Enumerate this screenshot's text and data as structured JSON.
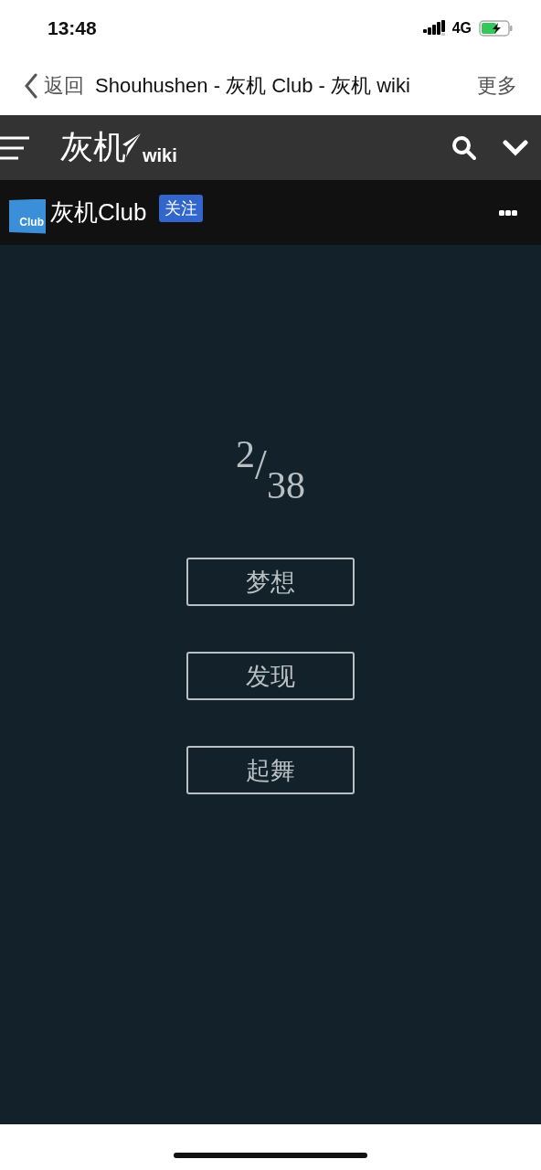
{
  "status_bar": {
    "time": "13:48",
    "network": "4G"
  },
  "nav_bar": {
    "back": "返回",
    "title": "Shouhushen - 灰机 Club - 灰机 wiki",
    "more": "更多"
  },
  "header": {
    "logo_name": "灰机",
    "logo_suffix": "wiki"
  },
  "club_bar": {
    "badge_text": "Club",
    "name": "灰机Club",
    "follow": "关注"
  },
  "counter": {
    "current": "2",
    "separator": "/",
    "total": "38"
  },
  "choices": [
    "梦想",
    "发现",
    "起舞"
  ]
}
